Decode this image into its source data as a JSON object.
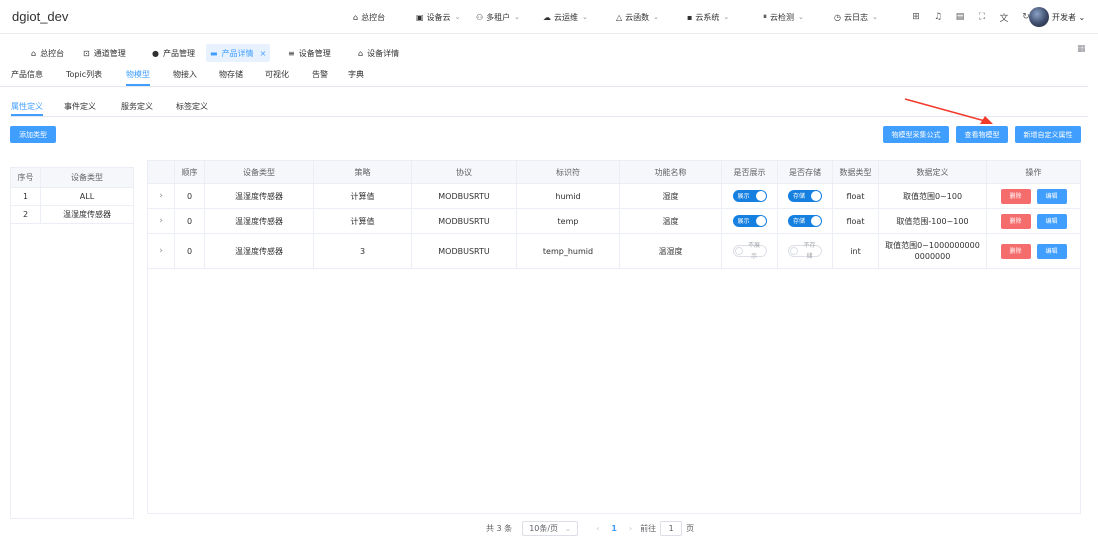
{
  "app": {
    "title": "dgiot_dev"
  },
  "topnav": [
    {
      "label": "总控台",
      "icon": "home-icon",
      "glyph": "⌂",
      "dropdown": false
    },
    {
      "label": "设备云",
      "icon": "device-cloud-icon",
      "glyph": "▣",
      "dropdown": true
    },
    {
      "label": "多租户",
      "icon": "tenant-icon",
      "glyph": "⚇",
      "dropdown": true
    },
    {
      "label": "云运维",
      "icon": "ops-icon",
      "glyph": "☁",
      "dropdown": true
    },
    {
      "label": "云函数",
      "icon": "function-icon",
      "glyph": "△",
      "dropdown": true
    },
    {
      "label": "云系统",
      "icon": "system-icon",
      "glyph": "▪",
      "dropdown": true
    },
    {
      "label": "云检测",
      "icon": "monitor-icon",
      "glyph": "⏸",
      "dropdown": true
    },
    {
      "label": "云日志",
      "icon": "log-icon",
      "glyph": "◷",
      "dropdown": true
    }
  ],
  "user": {
    "name": "开发者"
  },
  "tags": [
    {
      "label": "总控台",
      "icon": "home-icon",
      "glyph": "⌂"
    },
    {
      "label": "通道管理",
      "icon": "channel-icon",
      "glyph": "⊡"
    },
    {
      "label": "产品管理",
      "icon": "product-icon",
      "glyph": "●"
    },
    {
      "label": "产品详情",
      "icon": "product-detail-icon",
      "glyph": "▬",
      "active": true,
      "close": "×"
    },
    {
      "label": "设备管理",
      "icon": "device-icon",
      "glyph": "≡"
    },
    {
      "label": "设备详情",
      "icon": "device-detail-icon",
      "glyph": "⌂"
    }
  ],
  "tabs1": [
    "产品信息",
    "Topic列表",
    "物模型",
    "物接入",
    "物存储",
    "可视化",
    "告警",
    "字典"
  ],
  "tabs1_active": "物模型",
  "tabs2": [
    "属性定义",
    "事件定义",
    "服务定义",
    "标签定义"
  ],
  "tabs2_active": "属性定义",
  "buttons": {
    "add_type": "添加类型",
    "formula": "物模型采集公式",
    "view_model": "查看物模型",
    "add_custom": "新增自定义属性"
  },
  "left_table": {
    "headers": [
      "序号",
      "设备类型"
    ],
    "rows": [
      [
        "1",
        "ALL"
      ],
      [
        "2",
        "温湿度传感器"
      ]
    ]
  },
  "main_table": {
    "headers": [
      "顺序",
      "设备类型",
      "策略",
      "协议",
      "标识符",
      "功能名称",
      "是否展示",
      "是否存储",
      "数据类型",
      "数据定义",
      "操作"
    ],
    "rows": [
      {
        "order": "0",
        "type": "温湿度传感器",
        "strategy": "计算值",
        "protocol": "MODBUSRTU",
        "ident": "humid",
        "func": "湿度",
        "show": "展示",
        "show_on": true,
        "store": "存储",
        "store_on": true,
        "dtype": "float",
        "ddef": "取值范围0~100",
        "del": "删除",
        "edit": "编辑"
      },
      {
        "order": "0",
        "type": "温湿度传感器",
        "strategy": "计算值",
        "protocol": "MODBUSRTU",
        "ident": "temp",
        "func": "温度",
        "show": "展示",
        "show_on": true,
        "store": "存储",
        "store_on": true,
        "dtype": "float",
        "ddef": "取值范围-100~100",
        "del": "删除",
        "edit": "编辑"
      },
      {
        "order": "0",
        "type": "温湿度传感器",
        "strategy": "3",
        "protocol": "MODBUSRTU",
        "ident": "temp_humid",
        "func": "温湿度",
        "show": "不展示",
        "show_on": false,
        "store": "不存储",
        "store_on": false,
        "dtype": "int",
        "ddef": "取值范围0~10000000000000000",
        "del": "删除",
        "edit": "编辑"
      }
    ]
  },
  "pagination": {
    "total": "共 3 条",
    "page_size": "10条/页",
    "current": "1",
    "goto_label": "前往",
    "goto_value": "1",
    "page_suffix": "页"
  },
  "colors": {
    "primary": "#409eff",
    "danger": "#f56c6c",
    "annotation_arrow": "#f23a2a"
  }
}
